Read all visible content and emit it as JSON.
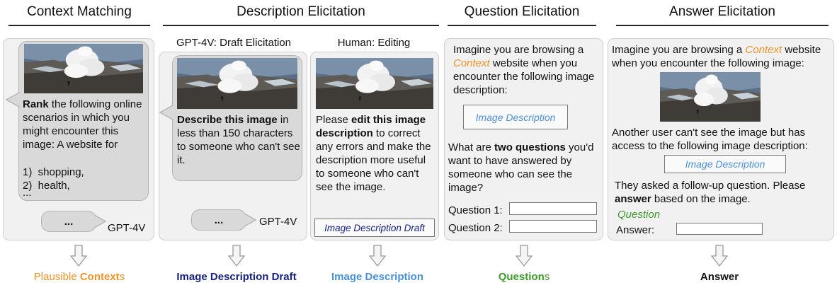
{
  "headers": {
    "context_matching": "Context Matching",
    "description_elicitation": "Description Elicitation",
    "question_elicitation": "Question Elicitation",
    "answer_elicitation": "Answer Elicitation"
  },
  "subheaders": {
    "draft": "GPT-4V: Draft Elicitation",
    "editing": "Human: Editing"
  },
  "context_panel": {
    "rank_bold": "Rank",
    "rank_rest": "the following online scenarios in which you might encounter this image: A website for",
    "item1": "1)  shopping,",
    "item2": "2)  health,",
    "item3": "...",
    "reply_dots": "...",
    "model": "GPT-4V"
  },
  "draft_panel": {
    "bold": "Describe this image",
    "rest": "in less than 150 characters to someone who can't see it.",
    "reply_dots": "...",
    "model": "GPT-4V"
  },
  "edit_panel": {
    "pre": "Please",
    "bold": "edit this image description",
    "rest": "to correct any errors and make the description more useful to someone who can't see the image.",
    "box": "Image Description Draft"
  },
  "question_panel": {
    "pre": "Imagine you are browsing a",
    "context": "Context",
    "post": "website when you encounter the following image description:",
    "box": "Image Description",
    "q_pre": "What are",
    "q_bold": "two questions",
    "q_post": "you'd want to have answered by someone who can see the image?",
    "q1": "Question 1:",
    "q2": "Question 2:"
  },
  "answer_panel": {
    "pre": "Imagine you are browsing a",
    "context": "Context",
    "post": "website when you encounter the following image:",
    "line2": "Another user can't see the image but has access to the following image description:",
    "box": "Image Description",
    "ask": "They asked a follow-up question. Please",
    "ask_bold": "answer",
    "ask_post": "based on the image.",
    "question": "Question",
    "answer": "Answer:"
  },
  "outputs": {
    "contexts_pre": "Plausible",
    "contexts_bold": "Context",
    "contexts_post": "s",
    "draft": "Image Description Draft",
    "description": "Image Description",
    "questions_bold": "Question",
    "questions_post": "s",
    "answer": "Answer"
  },
  "colors": {
    "context_orange": "#f0932b",
    "navy": "#17237e",
    "light_blue": "#4a90d9",
    "green": "#3d9a2c",
    "panel_bg": "#f1f1f1",
    "bubble_bg": "#d9d9d9"
  }
}
